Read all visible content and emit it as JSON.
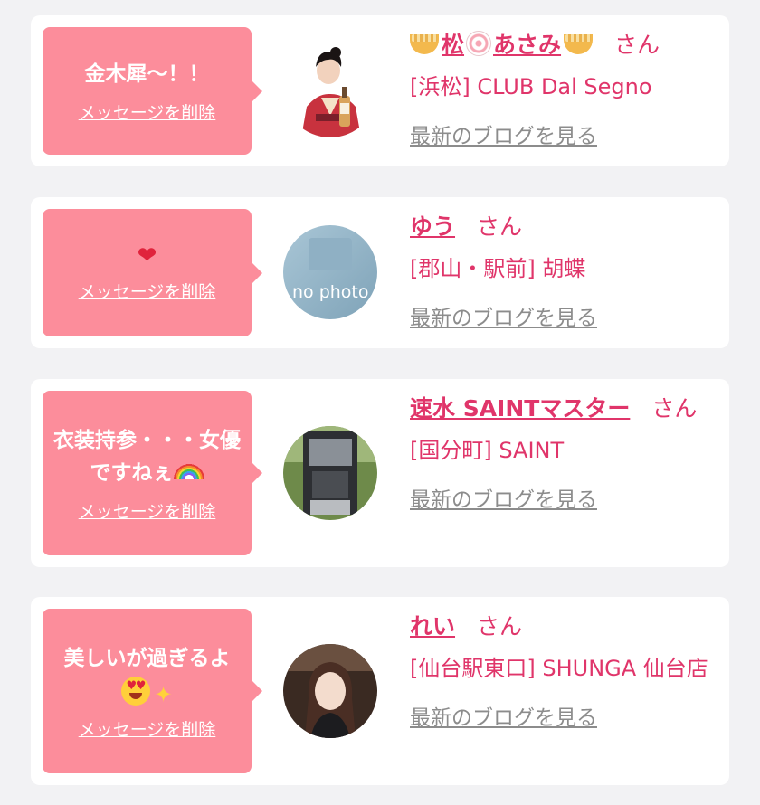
{
  "common": {
    "delete_label": "メッセージを削除",
    "san_label": "さん",
    "blog_label": "最新のブログを見る"
  },
  "items": [
    {
      "message": "金木犀〜！！",
      "name": "松あさみ",
      "area_shop": "[浜松] CLUB Dal Segno",
      "avatar_icon": "kimono-woman-with-bottle-photo"
    },
    {
      "message_icon": "heart-emoji",
      "name": "ゆう",
      "area_shop": "[郡山・駅前] 胡蝶",
      "avatar_icon": "no-photo-placeholder",
      "avatar_text": "no photo"
    },
    {
      "message": "衣装持参・・・女優ですねぇ",
      "message_icon": "rainbow-emoji",
      "name": "速水 SAINTマスター",
      "area_shop": "[国分町] SAINT",
      "avatar_icon": "van-interior-photo"
    },
    {
      "message": "美しいが過ぎるよ",
      "message_icon": "heart-eyes-sparkles-emoji",
      "name": "れい",
      "area_shop": "[仙台駅東口] SHUNGA 仙台店",
      "avatar_icon": "woman-portrait-photo"
    }
  ],
  "colors": {
    "bubble": "#fc8d9b",
    "name": "#e0356a",
    "blog_link": "#8c8c8c",
    "background": "#f2f2f4",
    "card": "#ffffff"
  }
}
